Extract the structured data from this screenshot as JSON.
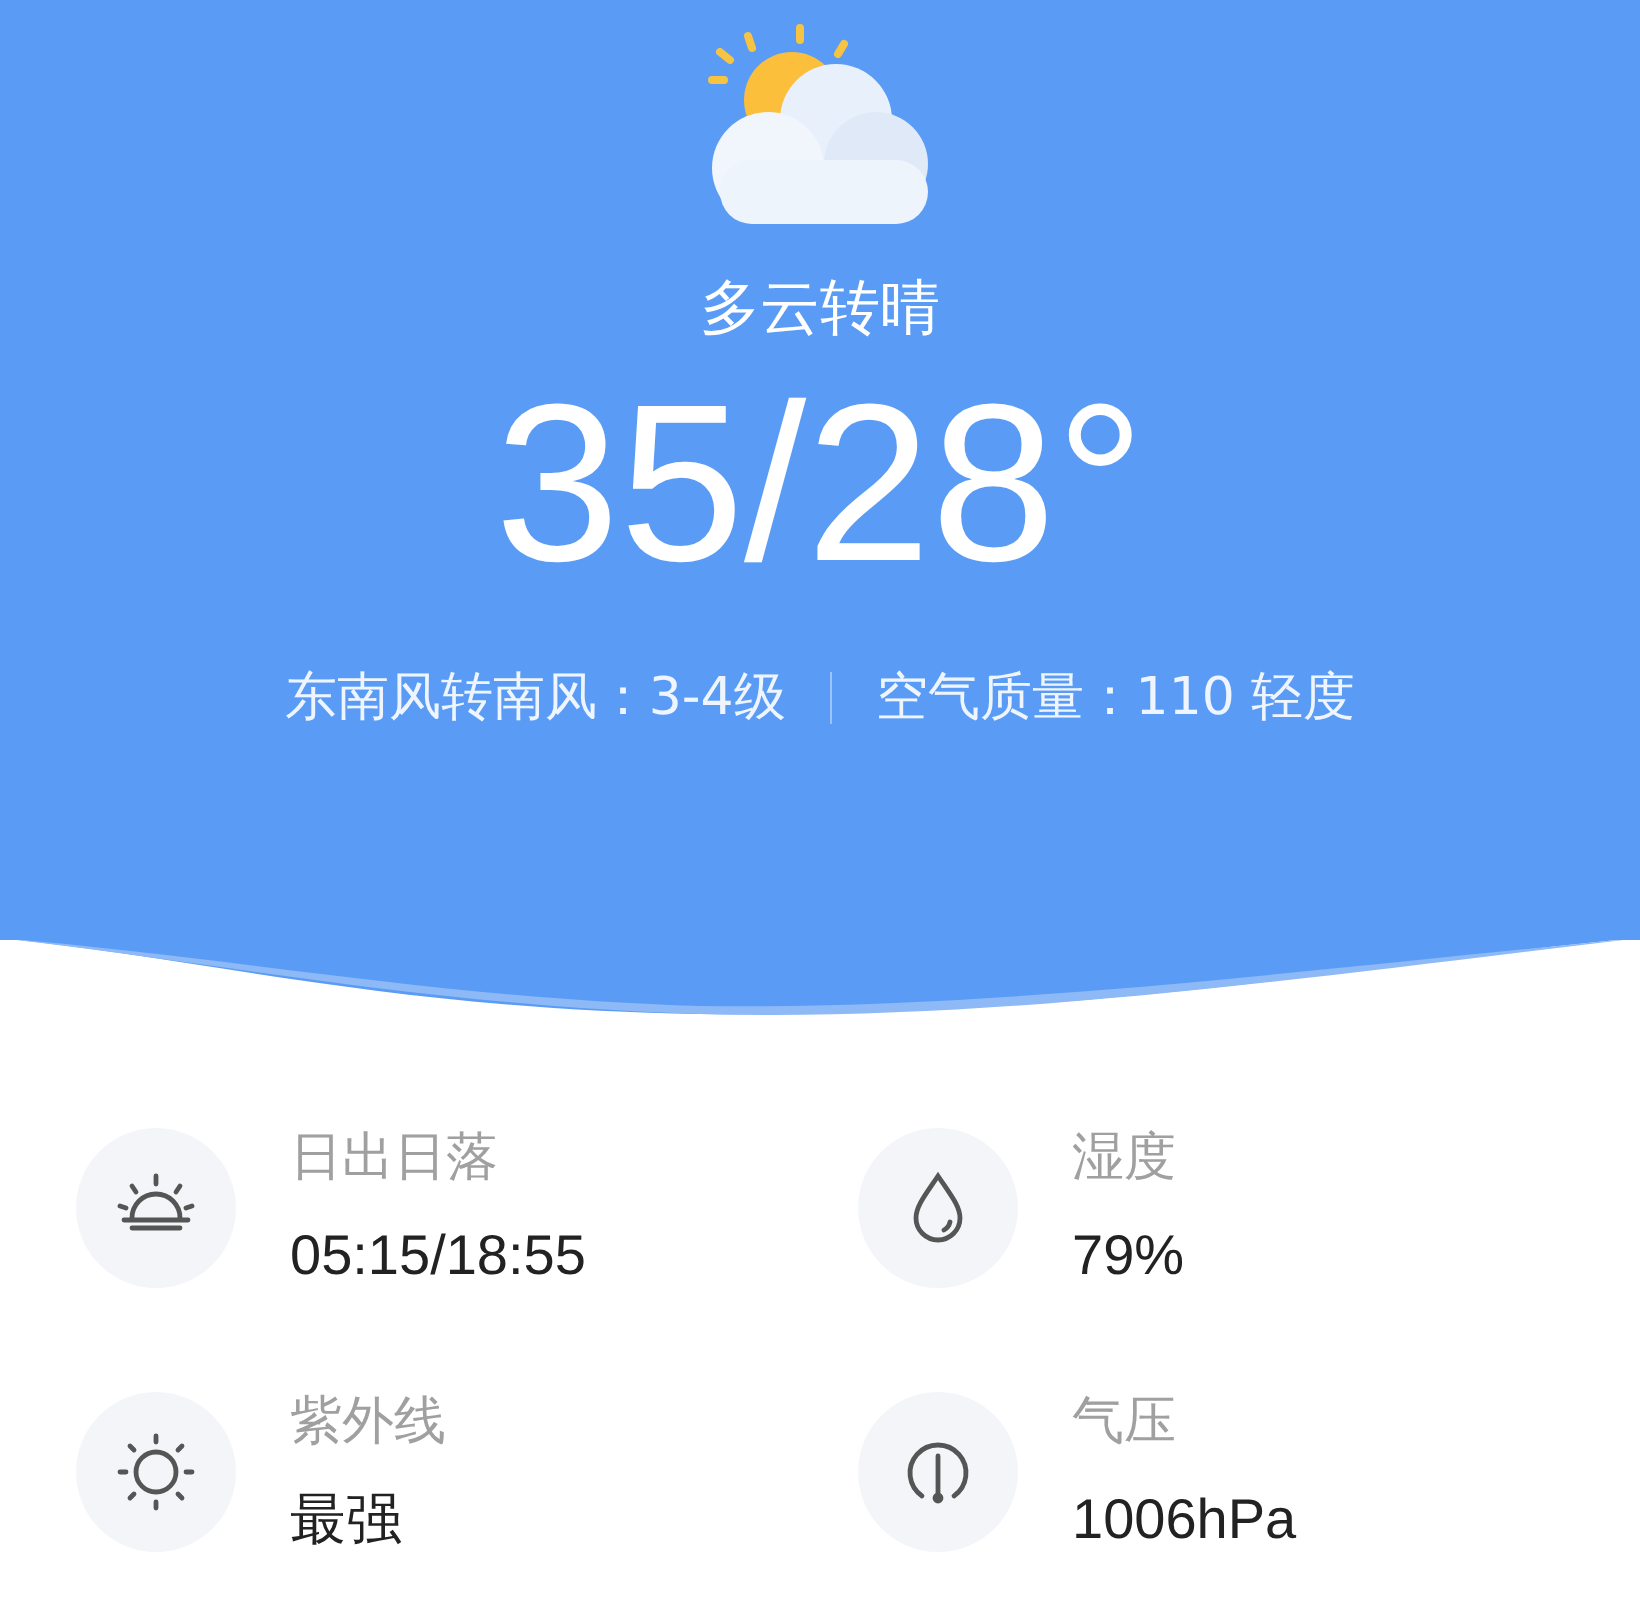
{
  "weather": {
    "condition": "多云转晴",
    "temperature": "35/28°",
    "wind": "东南风转南风：3-4级",
    "air_quality": "空气质量：110 轻度"
  },
  "details": [
    {
      "kind": "sunrise",
      "label": "日出日落",
      "value": "05:15/18:55"
    },
    {
      "kind": "humidity",
      "label": "湿度",
      "value": "79%"
    },
    {
      "kind": "uv",
      "label": "紫外线",
      "value": "最强"
    },
    {
      "kind": "pressure",
      "label": "气压",
      "value": "1006hPa"
    }
  ]
}
